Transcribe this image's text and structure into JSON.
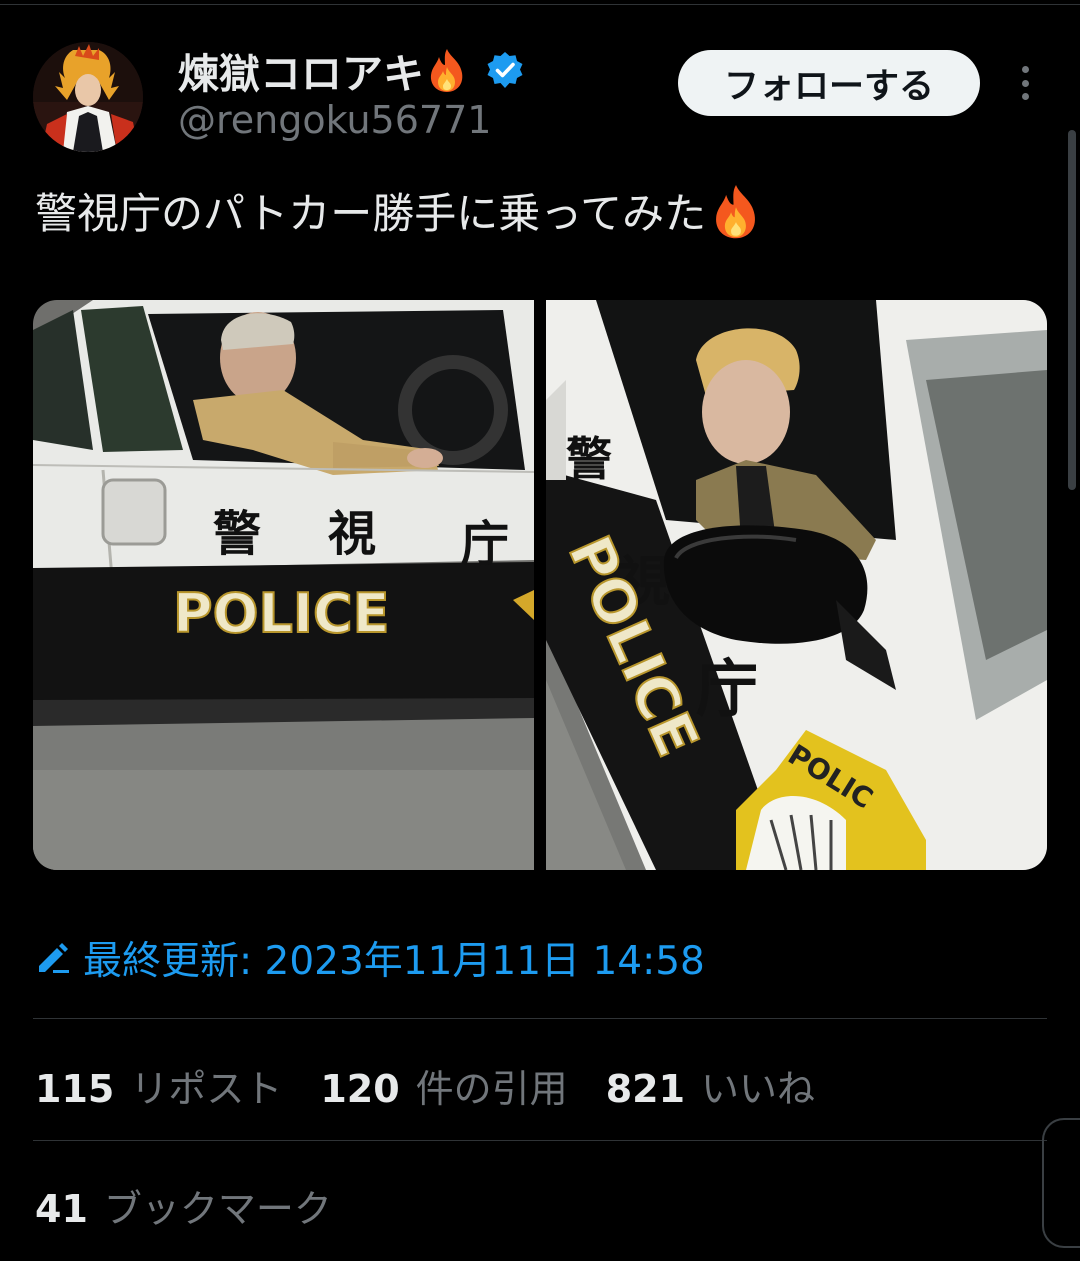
{
  "user": {
    "display_name": "煉獄コロアキ",
    "handle": "@rengoku56771",
    "verified": true,
    "avatar_icon": "avatar-cosplay-icon"
  },
  "actions": {
    "follow_label": "フォローする",
    "more_icon": "more-vertical-icon"
  },
  "tweet": {
    "text": "警視庁のパトカー勝手に乗ってみた",
    "emoji": "fire-emoji"
  },
  "media": {
    "photos": [
      {
        "car_text_kanji": [
          "警",
          "視",
          "庁"
        ],
        "car_text_police": "POLICE"
      },
      {
        "car_text_kanji": [
          "警",
          "視",
          "庁"
        ],
        "car_text_police": "POLICE",
        "badge_text": "POLIC"
      }
    ]
  },
  "edit_info": {
    "label": "最終更新: 2023年11月11日 14:58",
    "icon": "pencil-icon",
    "color": "#1d9bf0"
  },
  "stats": {
    "reposts": {
      "count": "115",
      "label": "リポスト"
    },
    "quotes": {
      "count": "120",
      "label": "件の引用"
    },
    "likes": {
      "count": "821",
      "label": "いいね"
    },
    "bookmarks": {
      "count": "41",
      "label": "ブックマーク"
    }
  },
  "colors": {
    "background": "#000000",
    "text_primary": "#e7e9ea",
    "text_secondary": "#71767b",
    "accent": "#1d9bf0",
    "divider": "#2f3336"
  }
}
